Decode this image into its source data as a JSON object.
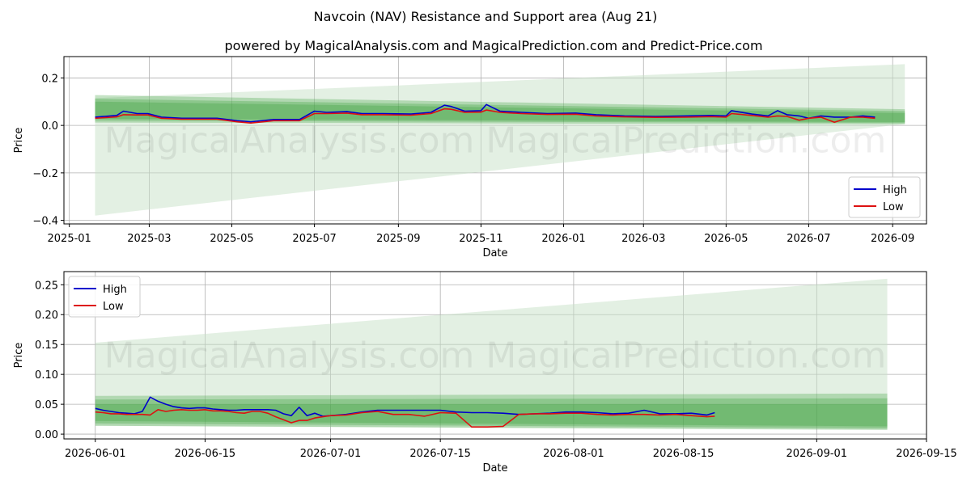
{
  "title": "Navcoin (NAV) Resistance and Support area (Aug 21)",
  "subtitle": "powered by MagicalAnalysis.com and MagicalPrediction.com and Predict-Price.com",
  "watermark": "MagicalAnalysis.com   MagicalPrediction.com",
  "colors": {
    "high": "#0000cc",
    "low": "#dd1111",
    "band": "#2e9a2e",
    "fan": "#c8e2c8",
    "grid": "#b0b0b0"
  },
  "chart_data": [
    {
      "type": "line",
      "xlabel": "Date",
      "ylabel": "Price",
      "xlim": [
        "2024-12-28",
        "2026-09-26"
      ],
      "ylim": [
        -0.415,
        0.29
      ],
      "x_ticks": [
        "2025-01",
        "2025-03",
        "2025-05",
        "2025-07",
        "2025-09",
        "2025-11",
        "2026-01",
        "2026-03",
        "2026-05",
        "2026-07",
        "2026-09"
      ],
      "y_ticks": [
        -0.4,
        -0.2,
        0.0,
        0.2
      ],
      "y_tick_labels": [
        "−0.4",
        "−0.2",
        "0.0",
        "0.2"
      ],
      "grid": true,
      "legend": "lower-right",
      "fan": {
        "x": [
          "2025-01-20",
          "2026-09-10"
        ],
        "upper": [
          0.115,
          0.258
        ],
        "lower": [
          -0.38,
          0.006
        ]
      },
      "bands": [
        {
          "x": [
            "2025-01-20",
            "2026-09-10"
          ],
          "upper": [
            0.128,
            0.068
          ],
          "lower": [
            0.012,
            0.005
          ]
        },
        {
          "x": [
            "2025-01-20",
            "2026-09-10"
          ],
          "upper": [
            0.112,
            0.06
          ],
          "lower": [
            0.02,
            0.01
          ]
        },
        {
          "x": [
            "2025-01-20",
            "2026-09-10"
          ],
          "upper": [
            0.1,
            0.052
          ],
          "lower": [
            0.028,
            0.014
          ]
        }
      ],
      "series": [
        {
          "name": "High",
          "x": [
            "2025-01-20",
            "2025-02-05",
            "2025-02-10",
            "2025-02-20",
            "2025-02-28",
            "2025-03-10",
            "2025-03-25",
            "2025-04-10",
            "2025-04-20",
            "2025-05-05",
            "2025-05-15",
            "2025-06-01",
            "2025-06-20",
            "2025-07-01",
            "2025-07-10",
            "2025-07-25",
            "2025-08-05",
            "2025-08-20",
            "2025-09-10",
            "2025-09-25",
            "2025-10-05",
            "2025-10-10",
            "2025-10-20",
            "2025-11-01",
            "2025-11-05",
            "2025-11-15",
            "2025-12-01",
            "2025-12-20",
            "2026-01-10",
            "2026-01-25",
            "2026-02-15",
            "2026-03-10",
            "2026-04-01",
            "2026-04-20",
            "2026-05-01",
            "2026-05-05",
            "2026-05-20",
            "2026-06-01",
            "2026-06-08",
            "2026-06-15",
            "2026-06-24",
            "2026-07-01",
            "2026-07-10",
            "2026-07-20",
            "2026-08-01",
            "2026-08-10",
            "2026-08-19"
          ],
          "values": [
            0.035,
            0.042,
            0.06,
            0.05,
            0.05,
            0.035,
            0.03,
            0.03,
            0.03,
            0.02,
            0.015,
            0.025,
            0.025,
            0.06,
            0.055,
            0.058,
            0.05,
            0.05,
            0.048,
            0.055,
            0.085,
            0.08,
            0.06,
            0.062,
            0.088,
            0.06,
            0.055,
            0.05,
            0.052,
            0.045,
            0.04,
            0.038,
            0.04,
            0.042,
            0.04,
            0.062,
            0.048,
            0.04,
            0.062,
            0.045,
            0.04,
            0.03,
            0.04,
            0.035,
            0.035,
            0.04,
            0.035
          ]
        },
        {
          "name": "Low",
          "x": [
            "2025-01-20",
            "2025-02-05",
            "2025-02-10",
            "2025-02-20",
            "2025-02-28",
            "2025-03-10",
            "2025-03-25",
            "2025-04-10",
            "2025-04-20",
            "2025-05-05",
            "2025-05-15",
            "2025-06-01",
            "2025-06-20",
            "2025-07-01",
            "2025-07-10",
            "2025-07-25",
            "2025-08-05",
            "2025-08-20",
            "2025-09-10",
            "2025-09-25",
            "2025-10-05",
            "2025-10-10",
            "2025-10-20",
            "2025-11-01",
            "2025-11-05",
            "2025-11-15",
            "2025-12-01",
            "2025-12-20",
            "2026-01-10",
            "2026-01-25",
            "2026-02-15",
            "2026-03-10",
            "2026-04-01",
            "2026-04-20",
            "2026-05-01",
            "2026-05-05",
            "2026-05-20",
            "2026-06-01",
            "2026-06-08",
            "2026-06-15",
            "2026-06-24",
            "2026-07-01",
            "2026-07-10",
            "2026-07-20",
            "2026-08-01",
            "2026-08-10",
            "2026-08-19"
          ],
          "values": [
            0.03,
            0.036,
            0.045,
            0.044,
            0.044,
            0.03,
            0.026,
            0.026,
            0.026,
            0.015,
            0.01,
            0.02,
            0.02,
            0.05,
            0.05,
            0.052,
            0.045,
            0.045,
            0.043,
            0.05,
            0.07,
            0.068,
            0.055,
            0.056,
            0.065,
            0.055,
            0.05,
            0.046,
            0.047,
            0.04,
            0.036,
            0.034,
            0.035,
            0.037,
            0.035,
            0.05,
            0.042,
            0.035,
            0.04,
            0.038,
            0.022,
            0.03,
            0.035,
            0.013,
            0.035,
            0.035,
            0.03
          ]
        }
      ]
    },
    {
      "type": "line",
      "xlabel": "Date",
      "ylabel": "Price",
      "xlim": [
        "2026-05-28",
        "2026-09-15"
      ],
      "ylim": [
        -0.008,
        0.272
      ],
      "x_ticks": [
        "2026-06-01",
        "2026-06-15",
        "2026-07-01",
        "2026-07-15",
        "2026-08-01",
        "2026-08-15",
        "2026-09-01",
        "2026-09-15"
      ],
      "y_ticks": [
        0.0,
        0.05,
        0.1,
        0.15,
        0.2,
        0.25
      ],
      "y_tick_labels": [
        "0.00",
        "0.05",
        "0.10",
        "0.15",
        "0.20",
        "0.25"
      ],
      "grid": true,
      "legend": "upper-left",
      "fan": {
        "x": [
          "2026-06-01",
          "2026-09-10"
        ],
        "upper": [
          0.153,
          0.26
        ],
        "lower": [
          0.014,
          0.008
        ]
      },
      "bands": [
        {
          "x": [
            "2026-06-01",
            "2026-09-10"
          ],
          "upper": [
            0.064,
            0.068
          ],
          "lower": [
            0.014,
            0.007
          ]
        },
        {
          "x": [
            "2026-06-01",
            "2026-09-10"
          ],
          "upper": [
            0.058,
            0.06
          ],
          "lower": [
            0.018,
            0.01
          ]
        },
        {
          "x": [
            "2026-06-01",
            "2026-09-10"
          ],
          "upper": [
            0.05,
            0.05
          ],
          "lower": [
            0.022,
            0.013
          ]
        }
      ],
      "series": [
        {
          "name": "High",
          "x": [
            "2026-06-01",
            "2026-06-02",
            "2026-06-03",
            "2026-06-04",
            "2026-06-05",
            "2026-06-06",
            "2026-06-07",
            "2026-06-08",
            "2026-06-09",
            "2026-06-10",
            "2026-06-11",
            "2026-06-12",
            "2026-06-13",
            "2026-06-14",
            "2026-06-15",
            "2026-06-16",
            "2026-06-17",
            "2026-06-18",
            "2026-06-19",
            "2026-06-20",
            "2026-06-21",
            "2026-06-22",
            "2026-06-23",
            "2026-06-24",
            "2026-06-25",
            "2026-06-26",
            "2026-06-27",
            "2026-06-28",
            "2026-06-29",
            "2026-06-30",
            "2026-07-01",
            "2026-07-03",
            "2026-07-05",
            "2026-07-07",
            "2026-07-09",
            "2026-07-11",
            "2026-07-13",
            "2026-07-15",
            "2026-07-17",
            "2026-07-19",
            "2026-07-21",
            "2026-07-23",
            "2026-07-25",
            "2026-07-27",
            "2026-07-29",
            "2026-07-31",
            "2026-08-02",
            "2026-08-04",
            "2026-08-06",
            "2026-08-08",
            "2026-08-10",
            "2026-08-12",
            "2026-08-14",
            "2026-08-16",
            "2026-08-18",
            "2026-08-19"
          ],
          "values": [
            0.043,
            0.04,
            0.038,
            0.036,
            0.035,
            0.034,
            0.038,
            0.062,
            0.055,
            0.05,
            0.046,
            0.044,
            0.043,
            0.044,
            0.044,
            0.042,
            0.041,
            0.04,
            0.04,
            0.041,
            0.041,
            0.041,
            0.041,
            0.04,
            0.034,
            0.031,
            0.045,
            0.031,
            0.035,
            0.03,
            0.031,
            0.033,
            0.037,
            0.04,
            0.04,
            0.04,
            0.04,
            0.04,
            0.037,
            0.036,
            0.036,
            0.035,
            0.033,
            0.034,
            0.035,
            0.037,
            0.037,
            0.036,
            0.034,
            0.035,
            0.04,
            0.034,
            0.034,
            0.035,
            0.032,
            0.036
          ]
        },
        {
          "name": "Low",
          "x": [
            "2026-06-01",
            "2026-06-02",
            "2026-06-03",
            "2026-06-04",
            "2026-06-05",
            "2026-06-06",
            "2026-06-07",
            "2026-06-08",
            "2026-06-09",
            "2026-06-10",
            "2026-06-11",
            "2026-06-12",
            "2026-06-13",
            "2026-06-14",
            "2026-06-15",
            "2026-06-16",
            "2026-06-17",
            "2026-06-18",
            "2026-06-19",
            "2026-06-20",
            "2026-06-21",
            "2026-06-22",
            "2026-06-23",
            "2026-06-24",
            "2026-06-25",
            "2026-06-26",
            "2026-06-27",
            "2026-06-28",
            "2026-06-29",
            "2026-06-30",
            "2026-07-01",
            "2026-07-03",
            "2026-07-05",
            "2026-07-07",
            "2026-07-09",
            "2026-07-11",
            "2026-07-13",
            "2026-07-15",
            "2026-07-17",
            "2026-07-19",
            "2026-07-21",
            "2026-07-23",
            "2026-07-25",
            "2026-07-27",
            "2026-07-29",
            "2026-07-31",
            "2026-08-02",
            "2026-08-04",
            "2026-08-06",
            "2026-08-08",
            "2026-08-10",
            "2026-08-12",
            "2026-08-14",
            "2026-08-16",
            "2026-08-18",
            "2026-08-19"
          ],
          "values": [
            0.037,
            0.036,
            0.034,
            0.034,
            0.033,
            0.033,
            0.033,
            0.032,
            0.041,
            0.038,
            0.04,
            0.041,
            0.04,
            0.04,
            0.041,
            0.039,
            0.039,
            0.038,
            0.036,
            0.035,
            0.038,
            0.038,
            0.035,
            0.029,
            0.024,
            0.019,
            0.023,
            0.023,
            0.027,
            0.029,
            0.031,
            0.032,
            0.036,
            0.038,
            0.033,
            0.033,
            0.03,
            0.036,
            0.035,
            0.012,
            0.012,
            0.013,
            0.033,
            0.034,
            0.034,
            0.035,
            0.035,
            0.033,
            0.032,
            0.033,
            0.033,
            0.032,
            0.033,
            0.031,
            0.029,
            0.03
          ]
        }
      ]
    }
  ]
}
